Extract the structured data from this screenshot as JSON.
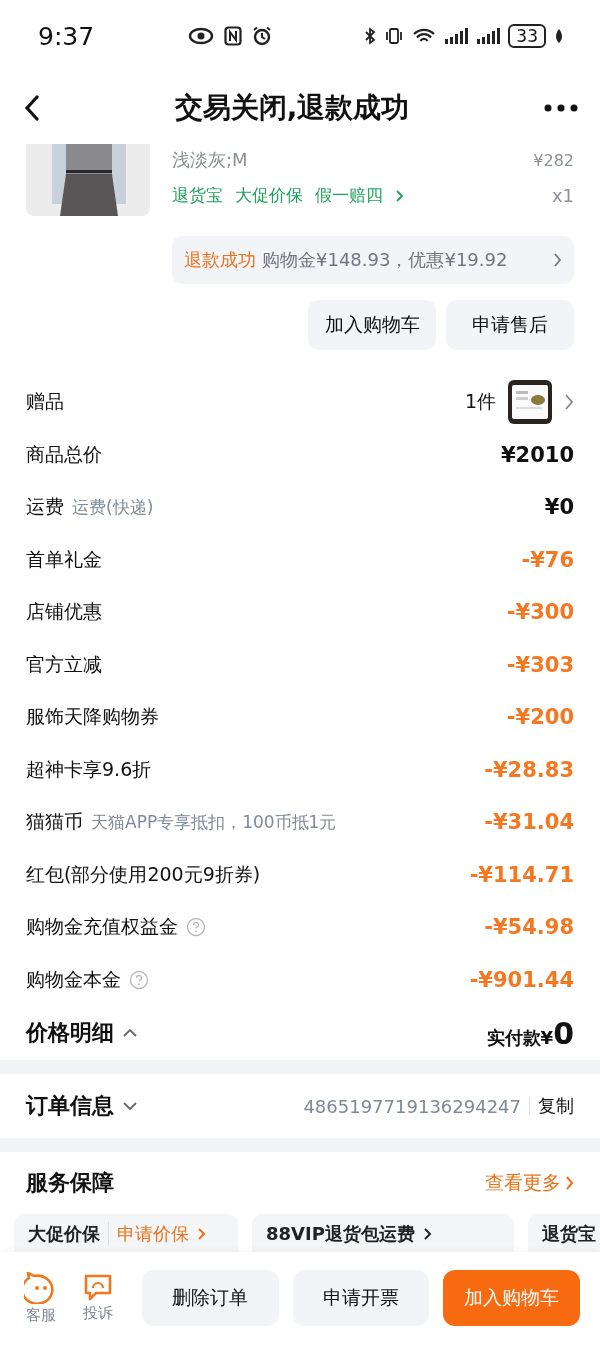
{
  "status_bar": {
    "time": "9:37",
    "battery": "33"
  },
  "header": {
    "title": "交易关闭,退款成功"
  },
  "product": {
    "variant": "浅淡灰;M",
    "price": "¥282",
    "quantity": "x1",
    "tags": [
      "退货宝",
      "大促价保",
      "假一赔四"
    ],
    "refund": {
      "status": "退款成功",
      "detail": "购物金¥148.93，优惠¥19.92"
    },
    "buttons": [
      "加入购物车",
      "申请售后"
    ]
  },
  "gift": {
    "label": "赠品",
    "count": "1件"
  },
  "price_rows": [
    {
      "label": "商品总价",
      "value": "¥2010",
      "kind": "plain"
    },
    {
      "label": "运费",
      "note": "运费(快递)",
      "value": "¥0",
      "kind": "plain"
    },
    {
      "label": "首单礼金",
      "value": "-¥76",
      "kind": "discount"
    },
    {
      "label": "店铺优惠",
      "value": "-¥300",
      "kind": "discount"
    },
    {
      "label": "官方立减",
      "value": "-¥303",
      "kind": "discount"
    },
    {
      "label": "服饰天降购物券",
      "value": "-¥200",
      "kind": "discount"
    },
    {
      "label": "超神卡享9.6折",
      "value": "-¥28.83",
      "kind": "discount"
    },
    {
      "label": "猫猫币",
      "note": "天猫APP专享抵扣，100币抵1元",
      "value": "-¥31.04",
      "kind": "discount"
    },
    {
      "label": "红包(部分使用200元9折券)",
      "value": "-¥114.71",
      "kind": "discount"
    },
    {
      "label": "购物金充值权益金",
      "help": true,
      "value": "-¥54.98",
      "kind": "discount"
    },
    {
      "label": "购物金本金",
      "help": true,
      "value": "-¥901.44",
      "kind": "discount"
    }
  ],
  "price_detail": {
    "label": "价格明细",
    "expanded": true,
    "paid_label": "实付款¥",
    "paid_amount": "0"
  },
  "order_info": {
    "label": "订单信息",
    "expanded": false,
    "order_number": "4865197719136294247",
    "copy": "复制"
  },
  "services": {
    "title": "服务保障",
    "more": "查看更多",
    "cards": [
      {
        "title": "大促价保",
        "action": "申请价保"
      },
      {
        "title": "88VIP退货包运费"
      },
      {
        "title": "退货宝"
      }
    ]
  },
  "bottom_bar": {
    "icons": [
      {
        "label": "客服",
        "kind": "service"
      },
      {
        "label": "投诉",
        "kind": "complaint"
      }
    ],
    "buttons": [
      {
        "label": "删除订单",
        "primary": false
      },
      {
        "label": "申请开票",
        "primary": false
      },
      {
        "label": "加入购物车",
        "primary": true
      }
    ]
  }
}
